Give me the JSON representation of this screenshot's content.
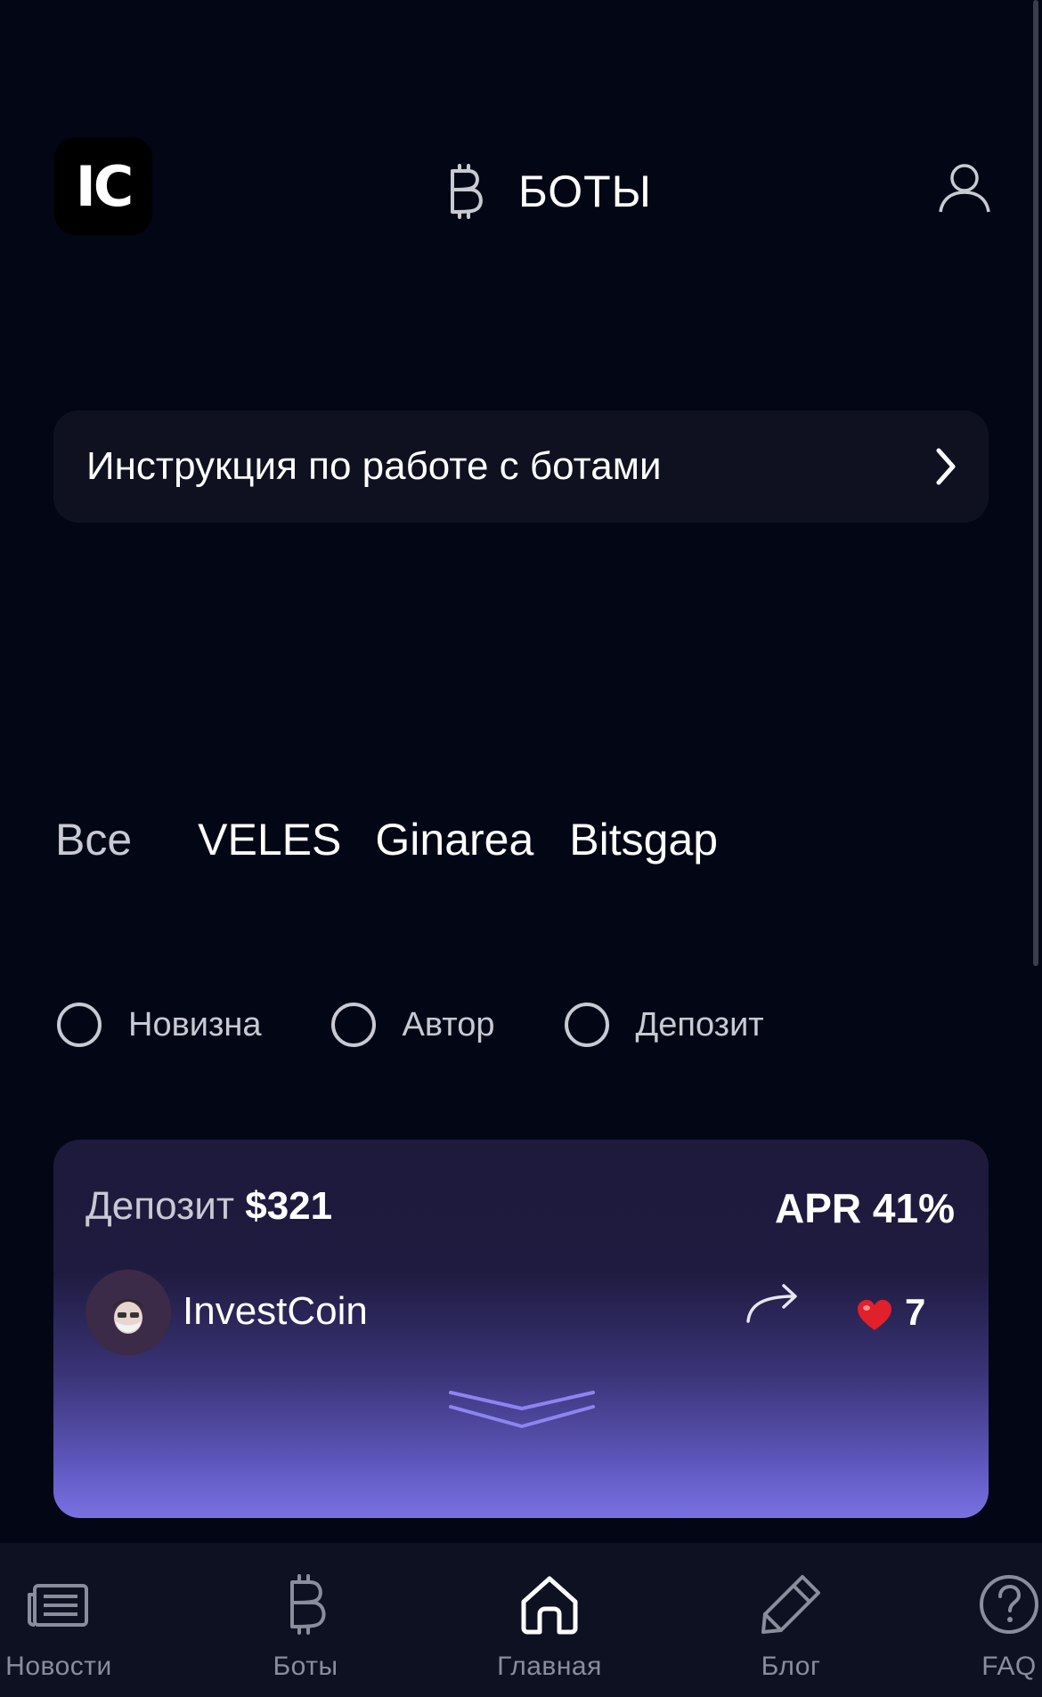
{
  "header": {
    "logo_text": "IC",
    "title": "БОТЫ",
    "title_icon": "bitcoin-icon",
    "profile_icon": "user-icon"
  },
  "instruction": {
    "label": "Инструкция по работе с ботами",
    "icon": "chevron-right-icon"
  },
  "tabs": [
    {
      "label": "Все"
    },
    {
      "label": "VELES"
    },
    {
      "label": "Ginarea"
    },
    {
      "label": "Bitsgap"
    }
  ],
  "sort_options": [
    {
      "label": "Новизна",
      "selected": false
    },
    {
      "label": "Автор",
      "selected": false
    },
    {
      "label": "Депозит",
      "selected": false
    }
  ],
  "card": {
    "deposit_label": "Депозит",
    "deposit_value": "$321",
    "apr": "APR 41%",
    "author": "InvestCoin",
    "likes": "7",
    "icons": [
      "avatar",
      "share-icon",
      "heart-icon",
      "expand-icon"
    ]
  },
  "nav": [
    {
      "label": "Новости",
      "icon": "news-icon"
    },
    {
      "label": "Боты",
      "icon": "bitcoin-icon"
    },
    {
      "label": "Главная",
      "icon": "home-icon",
      "active": true
    },
    {
      "label": "Блог",
      "icon": "pencil-icon"
    },
    {
      "label": "FAQ",
      "icon": "question-icon"
    }
  ],
  "colors": {
    "background": "#030614",
    "panel": "#0f1120",
    "nav": "#0e1122",
    "muted_text": "#c8c9d3",
    "accent": "#7a71e2"
  }
}
